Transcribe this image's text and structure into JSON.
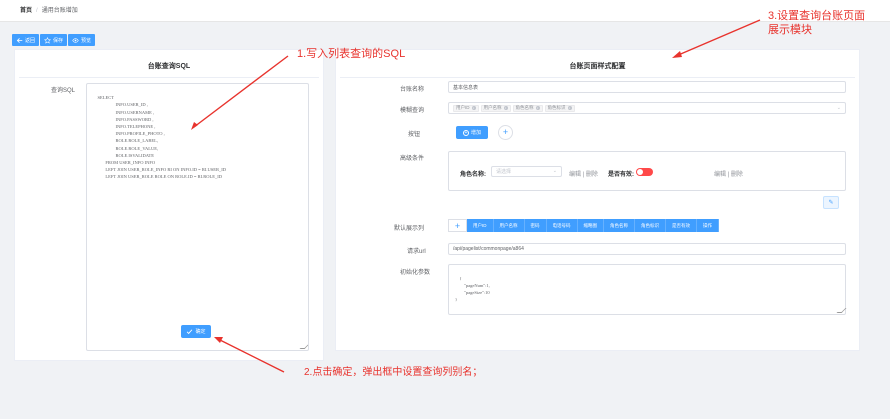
{
  "breadcrumb": {
    "home": "首页",
    "separator": "/",
    "current": "通用台账增加"
  },
  "toolbar": [
    {
      "label": "返回",
      "icon": "back-arrow-icon"
    },
    {
      "label": "保存",
      "icon": "star-icon"
    },
    {
      "label": "预览",
      "icon": "eye-icon"
    }
  ],
  "left_panel": {
    "title": "台账查询SQL",
    "sql_label": "查询SQL",
    "sql_text": "SELECT\n                    INFO.USER_ID ,\n                    INFO.USERNAME ,\n                    INFO.PASSWORD ,\n                    INFO.TELEPHONE ,\n                    INFO.PROFILE_PHOTO ,\n                    ROLE.ROLE_LABEL,\n                    ROLE.ROLE_VALUE,\n                    ROLE.ISVALIDATE\n           FROM USER_INFO INFO\n           LEFT JOIN USER_ROLE_INFO RI ON INFO.ID = RI.USER_ID\n           LEFT JOIN USER_ROLE ROLE ON ROLE.ID = RI.ROLE_ID",
    "confirm_label": "确定"
  },
  "right_panel": {
    "title": "台账页面样式配置",
    "name_label": "台账名称",
    "name_value": "基本信息表",
    "fuzzy_label": "模糊查询",
    "fuzzy_tags": [
      "用户ID",
      "用户名称",
      "角色名称",
      "角色标识"
    ],
    "button_label": "按钮",
    "add_label": "增加",
    "advanced_label": "高级条件",
    "adv_role_label": "角色名称:",
    "adv_select_placeholder": "请选择",
    "adv_edit_delete_1": "编辑 | 删除",
    "adv_valid_label": "是否有效:",
    "adv_edit_delete_2": "编辑 | 删除",
    "default_cols_label": "默认展示列",
    "columns": [
      "用户ID",
      "用户名称",
      "密码",
      "电话号码",
      "缩略图",
      "角色名称",
      "角色标识",
      "是否有效",
      "操作"
    ],
    "url_label": "请求url",
    "url_value": "/api/pagelist/commonpage/a864",
    "init_label": "初始化参数",
    "init_value": "{\n        \"pageNum\":1,\n        \"pageSize\":10\n}"
  },
  "annotations": {
    "a1": "1.写入列表查询的SQL",
    "a2": "2.点击确定，弹出框中设置查询列别名；",
    "a3_line1": "3.设置查询台账页面",
    "a3_line2": "展示模块"
  },
  "colors": {
    "primary": "#409eff",
    "annotation": "#e8332d",
    "toggle_off": "#ff4949"
  }
}
